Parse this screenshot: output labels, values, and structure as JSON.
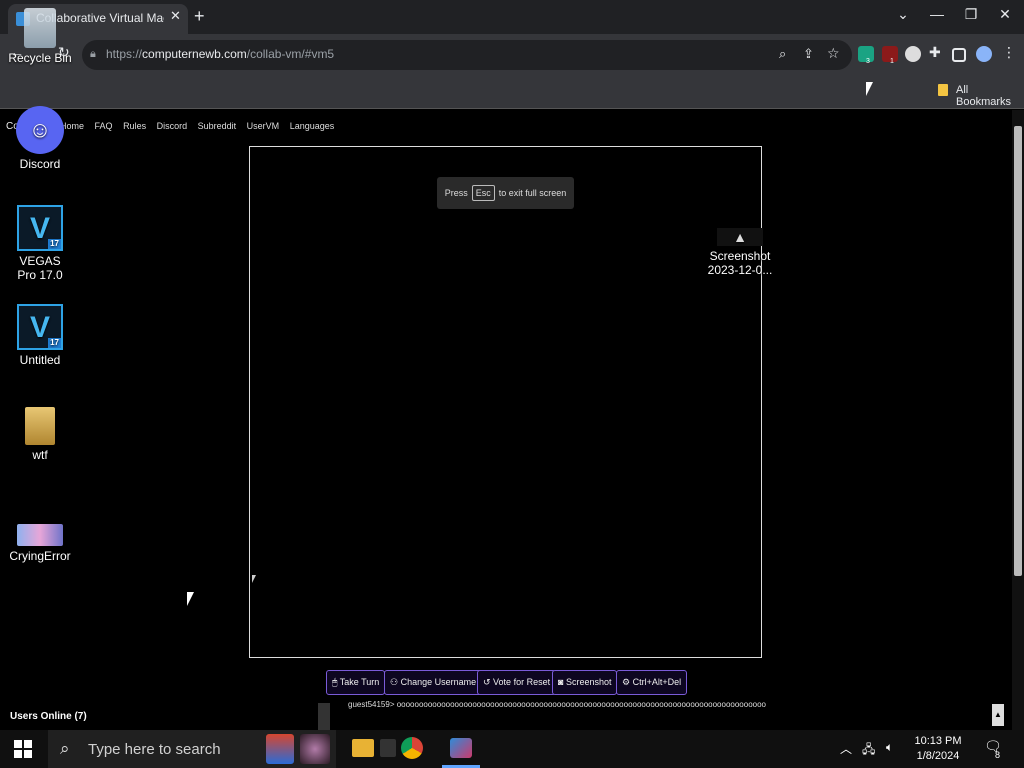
{
  "browser": {
    "tab_title": "Collaborative Virtual Machine",
    "url_scheme": "https://",
    "url_host": "computernewb.com",
    "url_path": "/collab-vm/#vm5",
    "all_bookmarks": "All Bookmarks",
    "ext_badges": [
      "3",
      "1"
    ]
  },
  "desktop_icons": [
    {
      "label": "Recycle Bin"
    },
    {
      "label": "Discord"
    },
    {
      "label": "VEGAS Pro 17.0",
      "badge": "17"
    },
    {
      "label": "Untitled",
      "badge": "17"
    },
    {
      "label": "wtf"
    },
    {
      "label": "CryingError"
    },
    {
      "label": "Screenshot 2023-12-0..."
    }
  ],
  "site_nav": {
    "brand": "Co",
    "items": [
      "Home",
      "FAQ",
      "Rules",
      "Discord",
      "Subreddit",
      "UserVM",
      "Languages"
    ]
  },
  "vm": {
    "toast_press": "Press",
    "toast_key": "Esc",
    "toast_rest": "to exit full screen"
  },
  "controls": {
    "take_turn": "Take Turn",
    "change_username": "Change Username",
    "vote_reset": "Vote for Reset",
    "screenshot": "Screenshot",
    "ctrl_alt_del": "Ctrl+Alt+Del"
  },
  "chat": {
    "users_online": "Users Online (7)",
    "line": "guest54159> oooooooooooooooooooooooooooooooooooooooooooooooooooooooooooooooooooooooooooooooooooooooooo"
  },
  "taskbar": {
    "search_placeholder": "Type here to search",
    "time": "10:13 PM",
    "date": "1/8/2024",
    "notification_count": "8"
  },
  "colors": {
    "accent_border": "#7a5bd8",
    "vegas_blue": "#2ea3e6",
    "discord": "#5865f2"
  }
}
